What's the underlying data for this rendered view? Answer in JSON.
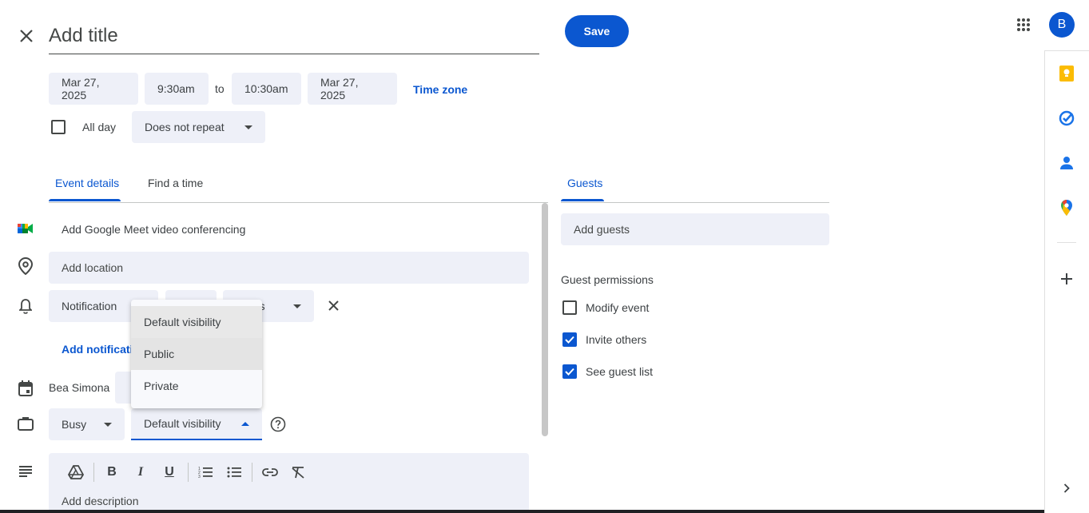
{
  "header": {
    "title_placeholder": "Add title",
    "save_label": "Save",
    "avatar_letter": "B"
  },
  "datetime": {
    "start_date": "Mar 27, 2025",
    "start_time": "9:30am",
    "to_label": "to",
    "end_time": "10:30am",
    "end_date": "Mar 27, 2025",
    "timezone_label": "Time zone",
    "all_day_label": "All day",
    "repeat_value": "Does not repeat"
  },
  "tabs": {
    "event_details": "Event details",
    "find_a_time": "Find a time",
    "guests": "Guests"
  },
  "details": {
    "meet_label": "Add Google Meet video conferencing",
    "location_placeholder": "Add location",
    "notification_type": "Notification",
    "notification_unit_partial": "tes",
    "add_notification_partial": "Add notificati",
    "owner_name": "Bea Simona",
    "availability": "Busy",
    "visibility": "Default visibility",
    "description_placeholder": "Add description"
  },
  "visibility_menu": {
    "options": [
      "Default visibility",
      "Public",
      "Private"
    ]
  },
  "guests": {
    "add_placeholder": "Add guests",
    "permissions_title": "Guest permissions",
    "permissions": [
      {
        "label": "Modify event",
        "checked": false
      },
      {
        "label": "Invite others",
        "checked": true
      },
      {
        "label": "See guest list",
        "checked": true
      }
    ]
  },
  "colors": {
    "accent": "#0b57d0",
    "chip_bg": "#eef0f8",
    "keep_yellow": "#fbbc04",
    "tasks_blue": "#1a73e8"
  }
}
